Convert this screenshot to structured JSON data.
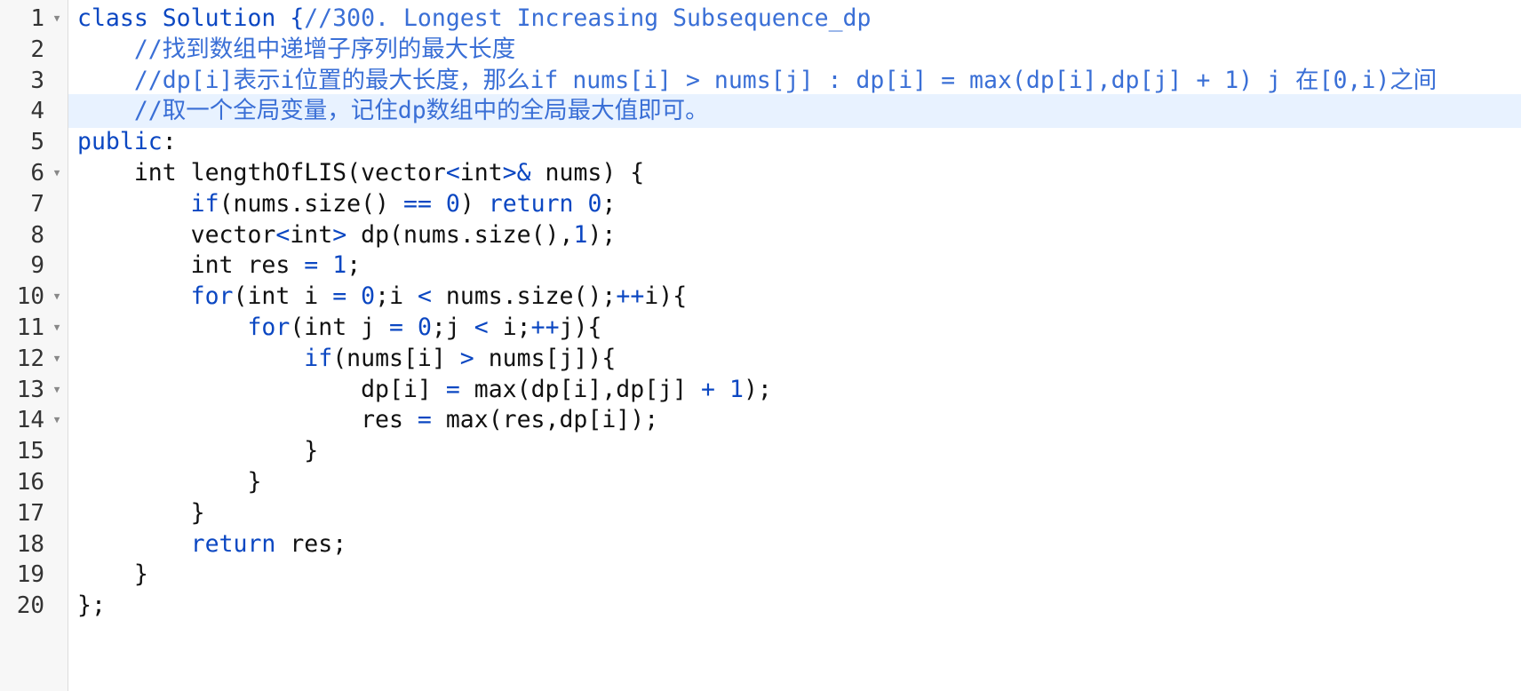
{
  "editor": {
    "active_line": 4,
    "colors": {
      "keyword": "#0b47c2",
      "comment": "#3a6fd6",
      "plain": "#111111",
      "gutter_bg": "#f7f7f7",
      "active_line_bg": "#e8f2ff",
      "fold_marker": "#888888"
    },
    "fold_icon": "triangle-down-icon",
    "lines": [
      {
        "n": "1",
        "fold": true,
        "tokens": [
          {
            "t": "class Solution {",
            "c": "kw"
          },
          {
            "t": "//300. Longest Increasing Subsequence_dp",
            "c": "cm"
          }
        ]
      },
      {
        "n": "2",
        "fold": false,
        "tokens": [
          {
            "t": "    ",
            "c": "pl"
          },
          {
            "t": "//找到数组中递增子序列的最大长度",
            "c": "cm"
          }
        ]
      },
      {
        "n": "3",
        "fold": false,
        "tokens": [
          {
            "t": "    ",
            "c": "pl"
          },
          {
            "t": "//dp[i]表示i位置的最大长度，那么if nums[i] > nums[j] : dp[i] = max(dp[i],dp[j] + 1) j 在[0,i)之间",
            "c": "cm"
          }
        ]
      },
      {
        "n": "4",
        "fold": false,
        "tokens": [
          {
            "t": "    ",
            "c": "pl"
          },
          {
            "t": "//取一个全局变量，记住dp数组中的全局最大值即可。",
            "c": "cm"
          }
        ]
      },
      {
        "n": "5",
        "fold": false,
        "tokens": [
          {
            "t": "public",
            "c": "kw"
          },
          {
            "t": ":",
            "c": "pl"
          }
        ]
      },
      {
        "n": "6",
        "fold": true,
        "tokens": [
          {
            "t": "    int lengthOfLIS(vector",
            "c": "pl"
          },
          {
            "t": "<",
            "c": "op"
          },
          {
            "t": "int",
            "c": "pl"
          },
          {
            "t": ">&",
            "c": "op"
          },
          {
            "t": " nums) {",
            "c": "pl"
          }
        ]
      },
      {
        "n": "7",
        "fold": false,
        "tokens": [
          {
            "t": "        ",
            "c": "pl"
          },
          {
            "t": "if",
            "c": "kw"
          },
          {
            "t": "(nums.size() ",
            "c": "pl"
          },
          {
            "t": "==",
            "c": "op"
          },
          {
            "t": " ",
            "c": "pl"
          },
          {
            "t": "0",
            "c": "num"
          },
          {
            "t": ") ",
            "c": "pl"
          },
          {
            "t": "return",
            "c": "kw"
          },
          {
            "t": " ",
            "c": "pl"
          },
          {
            "t": "0",
            "c": "num"
          },
          {
            "t": ";",
            "c": "pl"
          }
        ]
      },
      {
        "n": "8",
        "fold": false,
        "tokens": [
          {
            "t": "        vector",
            "c": "pl"
          },
          {
            "t": "<",
            "c": "op"
          },
          {
            "t": "int",
            "c": "pl"
          },
          {
            "t": ">",
            "c": "op"
          },
          {
            "t": " dp(nums.size(),",
            "c": "pl"
          },
          {
            "t": "1",
            "c": "num"
          },
          {
            "t": ");",
            "c": "pl"
          }
        ]
      },
      {
        "n": "9",
        "fold": false,
        "tokens": [
          {
            "t": "        int res ",
            "c": "pl"
          },
          {
            "t": "=",
            "c": "op"
          },
          {
            "t": " ",
            "c": "pl"
          },
          {
            "t": "1",
            "c": "num"
          },
          {
            "t": ";",
            "c": "pl"
          }
        ]
      },
      {
        "n": "10",
        "fold": true,
        "tokens": [
          {
            "t": "        ",
            "c": "pl"
          },
          {
            "t": "for",
            "c": "kw"
          },
          {
            "t": "(int i ",
            "c": "pl"
          },
          {
            "t": "=",
            "c": "op"
          },
          {
            "t": " ",
            "c": "pl"
          },
          {
            "t": "0",
            "c": "num"
          },
          {
            "t": ";i ",
            "c": "pl"
          },
          {
            "t": "<",
            "c": "op"
          },
          {
            "t": " nums.size();",
            "c": "pl"
          },
          {
            "t": "++",
            "c": "op"
          },
          {
            "t": "i){",
            "c": "pl"
          }
        ]
      },
      {
        "n": "11",
        "fold": true,
        "tokens": [
          {
            "t": "            ",
            "c": "pl"
          },
          {
            "t": "for",
            "c": "kw"
          },
          {
            "t": "(int j ",
            "c": "pl"
          },
          {
            "t": "=",
            "c": "op"
          },
          {
            "t": " ",
            "c": "pl"
          },
          {
            "t": "0",
            "c": "num"
          },
          {
            "t": ";j ",
            "c": "pl"
          },
          {
            "t": "<",
            "c": "op"
          },
          {
            "t": " i;",
            "c": "pl"
          },
          {
            "t": "++",
            "c": "op"
          },
          {
            "t": "j){",
            "c": "pl"
          }
        ]
      },
      {
        "n": "12",
        "fold": true,
        "tokens": [
          {
            "t": "                ",
            "c": "pl"
          },
          {
            "t": "if",
            "c": "kw"
          },
          {
            "t": "(nums[i] ",
            "c": "pl"
          },
          {
            "t": ">",
            "c": "op"
          },
          {
            "t": " nums[j]){",
            "c": "pl"
          }
        ]
      },
      {
        "n": "13",
        "fold": true,
        "tokens": [
          {
            "t": "                    dp[i] ",
            "c": "pl"
          },
          {
            "t": "=",
            "c": "op"
          },
          {
            "t": " max(dp[i],dp[j] ",
            "c": "pl"
          },
          {
            "t": "+",
            "c": "op"
          },
          {
            "t": " ",
            "c": "pl"
          },
          {
            "t": "1",
            "c": "num"
          },
          {
            "t": ");",
            "c": "pl"
          }
        ]
      },
      {
        "n": "14",
        "fold": true,
        "tokens": [
          {
            "t": "                    res ",
            "c": "pl"
          },
          {
            "t": "=",
            "c": "op"
          },
          {
            "t": " max(res,dp[i]);",
            "c": "pl"
          }
        ]
      },
      {
        "n": "15",
        "fold": false,
        "tokens": [
          {
            "t": "                }",
            "c": "pl"
          }
        ]
      },
      {
        "n": "16",
        "fold": false,
        "tokens": [
          {
            "t": "            }",
            "c": "pl"
          }
        ]
      },
      {
        "n": "17",
        "fold": false,
        "tokens": [
          {
            "t": "        }",
            "c": "pl"
          }
        ]
      },
      {
        "n": "18",
        "fold": false,
        "tokens": [
          {
            "t": "        ",
            "c": "pl"
          },
          {
            "t": "return",
            "c": "kw"
          },
          {
            "t": " res;",
            "c": "pl"
          }
        ]
      },
      {
        "n": "19",
        "fold": false,
        "tokens": [
          {
            "t": "    }",
            "c": "pl"
          }
        ]
      },
      {
        "n": "20",
        "fold": false,
        "tokens": [
          {
            "t": "};",
            "c": "pl"
          }
        ]
      }
    ]
  }
}
